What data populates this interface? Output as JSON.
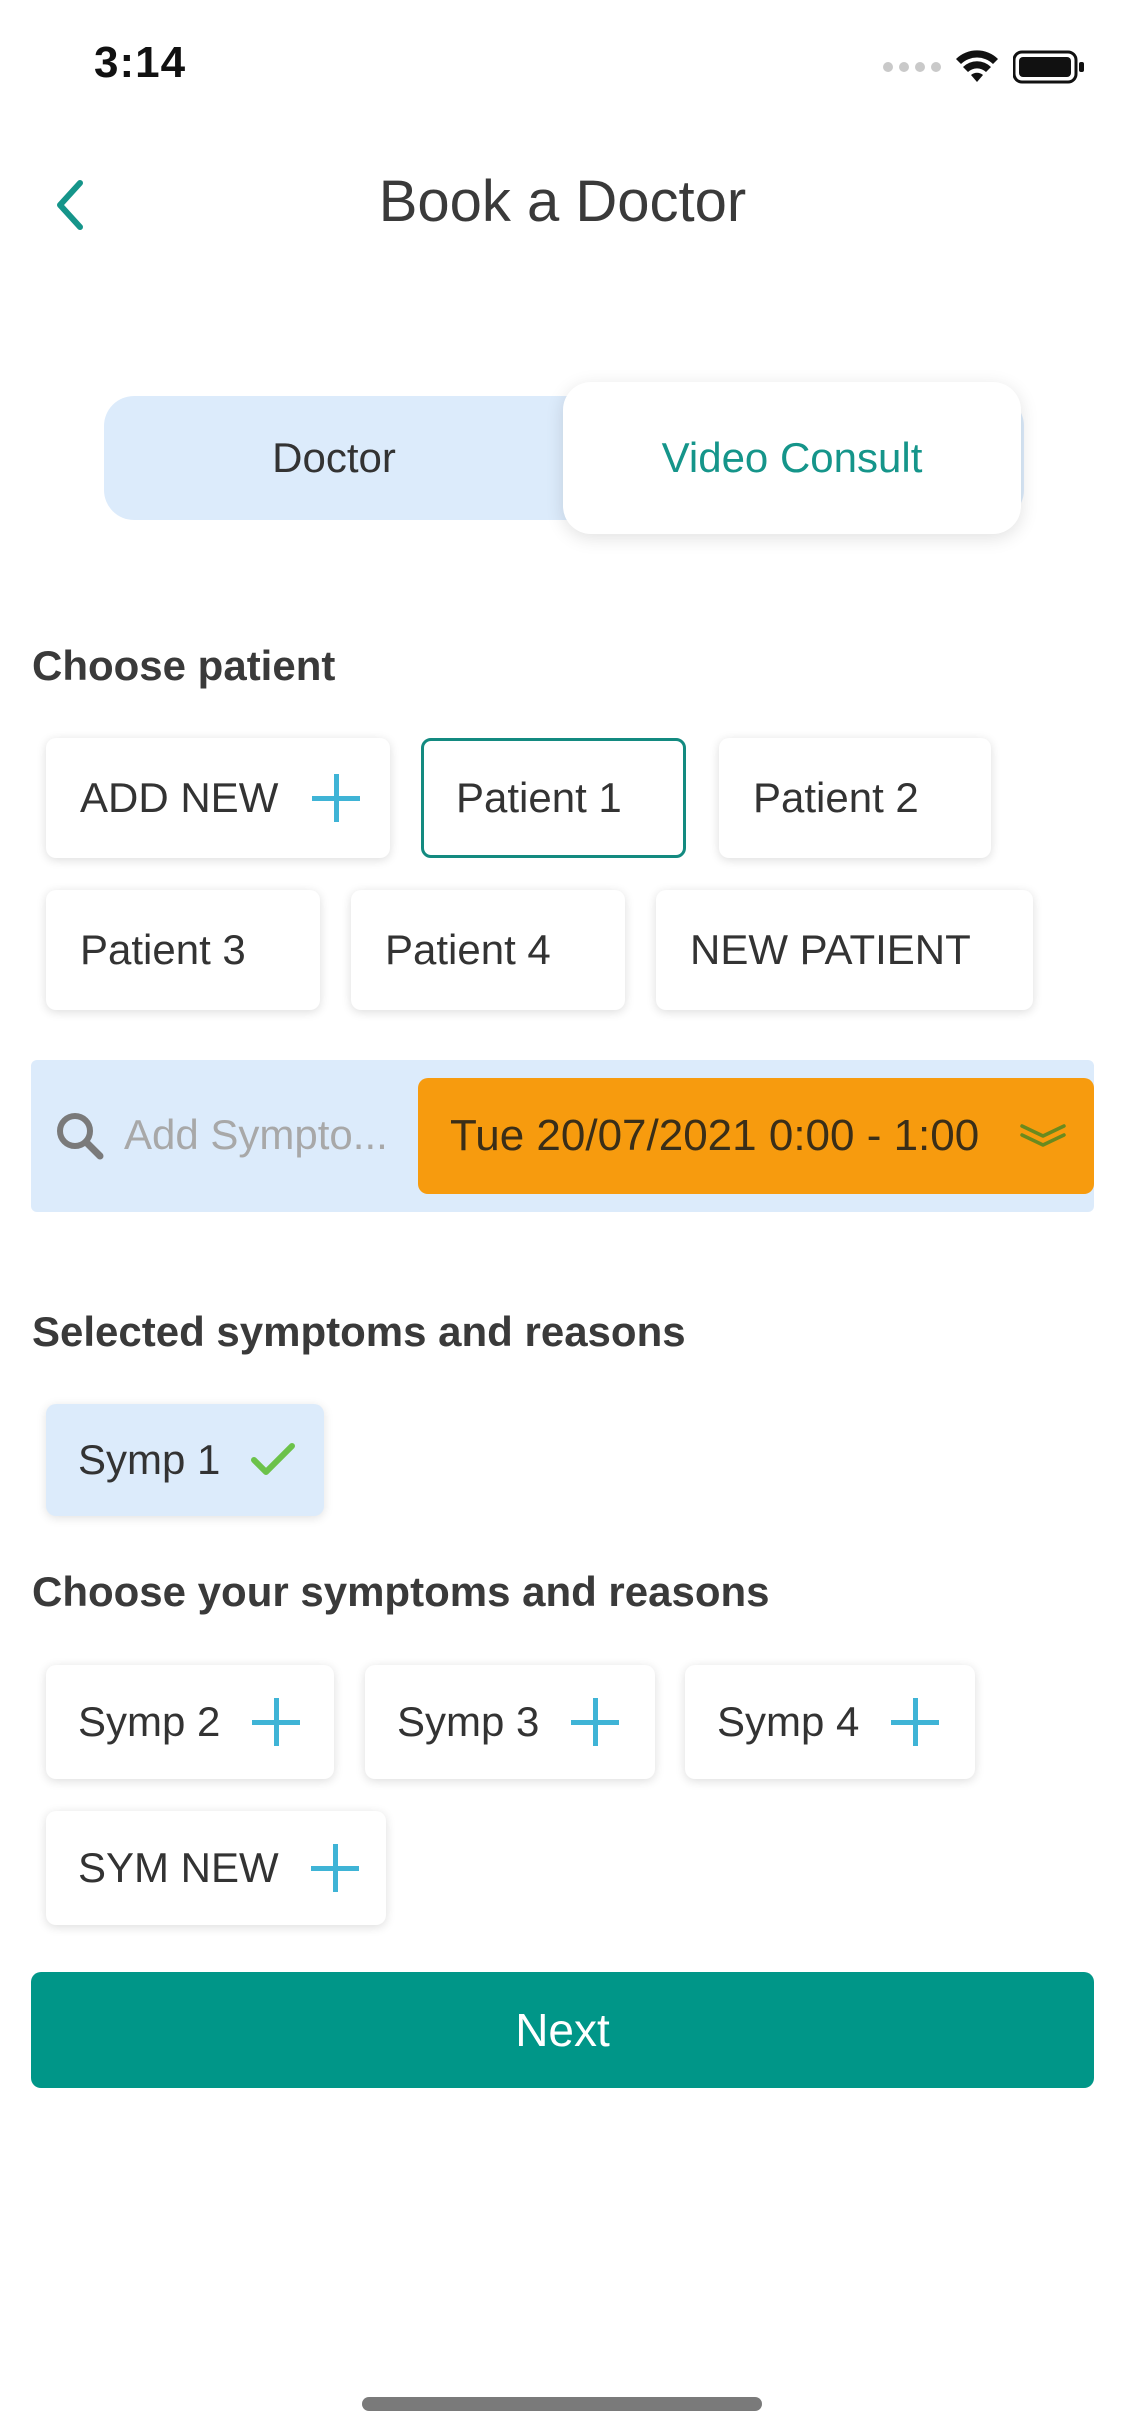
{
  "status_bar": {
    "time": "3:14"
  },
  "header": {
    "title": "Book a Doctor"
  },
  "segmented": {
    "doctor_label": "Doctor",
    "video_label": "Video Consult",
    "selected": "Video Consult"
  },
  "patients": {
    "section_title": "Choose patient",
    "add_new_label": "ADD NEW",
    "items": [
      "Patient 1",
      "Patient 2",
      "Patient 3",
      "Patient 4",
      "NEW PATIENT"
    ],
    "selected": "Patient 1"
  },
  "search": {
    "placeholder": "Add Sympto..."
  },
  "datetime": {
    "label": "Tue 20/07/2021 0:00 - 1:00"
  },
  "selected_symptoms": {
    "section_title": "Selected symptoms and reasons",
    "items": [
      "Symp 1"
    ]
  },
  "symptoms": {
    "section_title": "Choose your symptoms and reasons",
    "items": [
      "Symp 2",
      "Symp 3",
      "Symp 4",
      "SYM NEW"
    ]
  },
  "next_button": {
    "label": "Next"
  },
  "colors": {
    "accent": "#009688",
    "segment_bg": "#dcebfb",
    "date_bg": "#f79b0e",
    "plus_icon": "#3fb4d6",
    "check_icon": "#6cc24a"
  }
}
